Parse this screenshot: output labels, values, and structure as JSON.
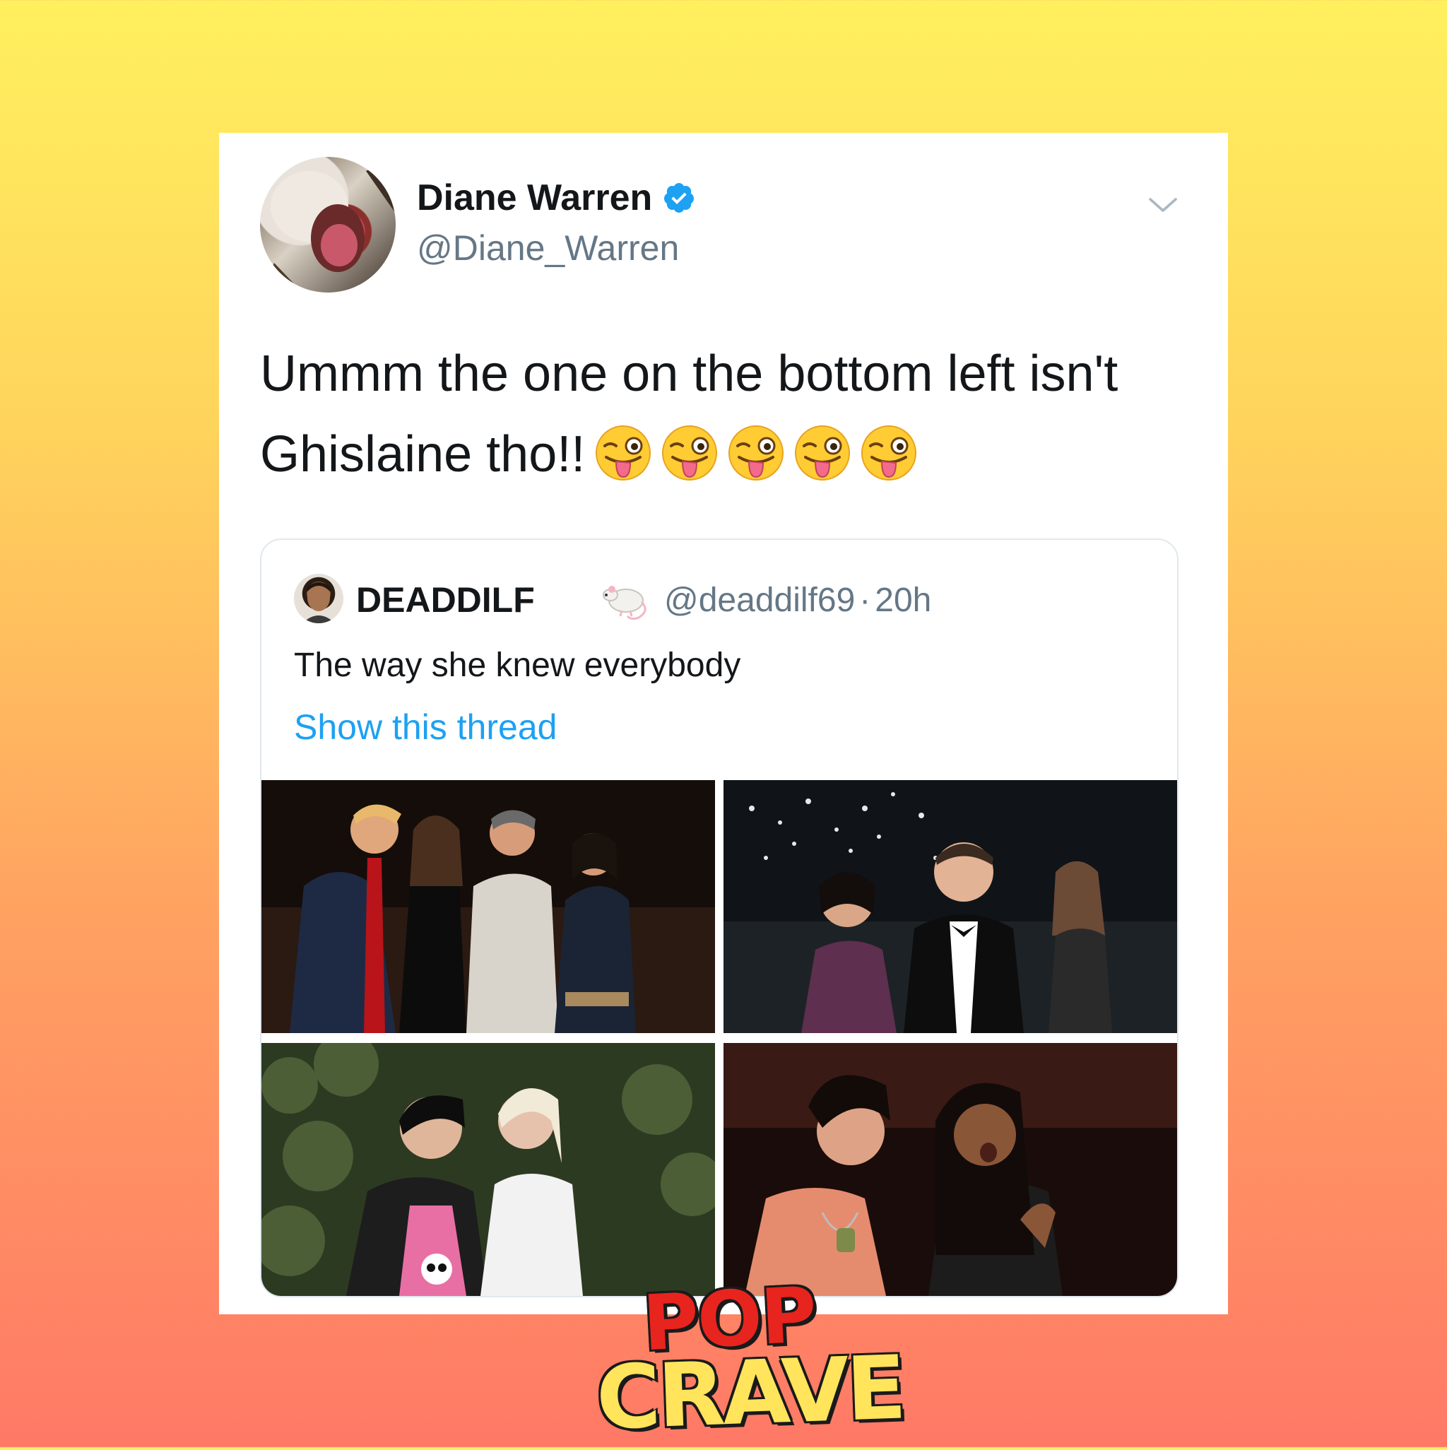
{
  "tweet": {
    "author_name": "Diane Warren",
    "author_handle": "@Diane_Warren",
    "verified": true,
    "text": "Ummm the one on the bottom left isn't Ghislaine tho!!",
    "emoji_count": 5,
    "emoji_name": "winking-face-with-tongue"
  },
  "quoted_tweet": {
    "author_name": "DEADDILF",
    "name_emoji": "rat",
    "author_handle": "@deaddilf69",
    "separator": "·",
    "time": "20h",
    "text": "The way she knew everybody",
    "thread_link": "Show this thread",
    "photos": [
      "photo-1",
      "photo-2",
      "photo-3",
      "photo-4"
    ]
  },
  "branding": {
    "logo_line1": "POP",
    "logo_line2": "CRAVE"
  },
  "colors": {
    "link": "#1da1f2",
    "secondary_text": "#657786",
    "primary_text": "#14171a",
    "verified_badge": "#1da1f2",
    "background_top": "#FFF05E",
    "background_bottom": "#FF7966"
  }
}
